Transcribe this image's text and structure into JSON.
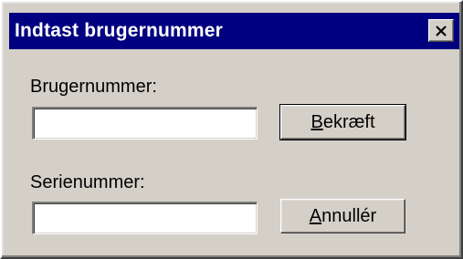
{
  "dialog": {
    "title": "Indtast brugernummer",
    "close_glyph": "×",
    "close_icon": "close-icon"
  },
  "form": {
    "user_label": "Brugernummer:",
    "user_value": "",
    "serial_label": "Serienummer:",
    "serial_value": ""
  },
  "buttons": {
    "confirm_mnemonic": "B",
    "confirm_rest": "ekræft",
    "cancel_mnemonic": "A",
    "cancel_rest": "nnullér"
  },
  "colors": {
    "titlebar": "#000080",
    "face": "#d4d0c8",
    "field": "#ffffff"
  }
}
